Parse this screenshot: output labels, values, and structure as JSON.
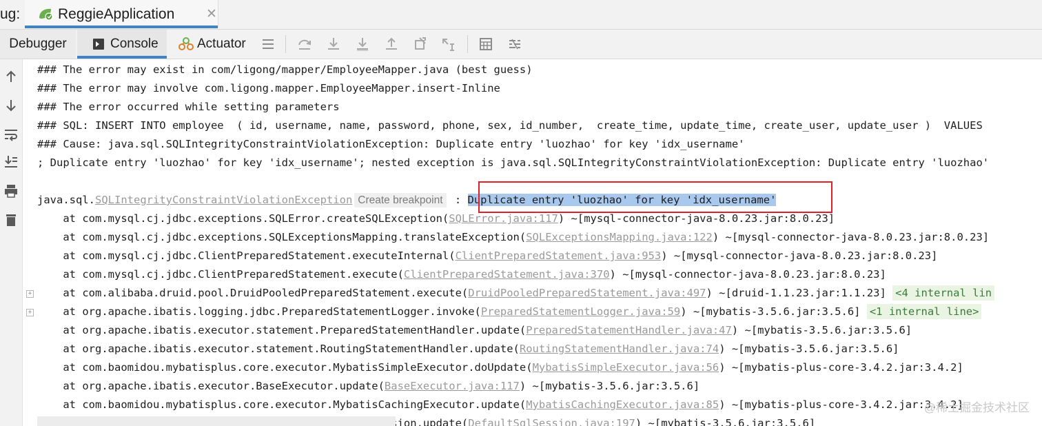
{
  "top_tab": {
    "prefix": "ug:",
    "title": "ReggieApplication",
    "close": "✕"
  },
  "toolbar": {
    "debugger_label": "Debugger",
    "console_label": "Console",
    "actuator_label": "Actuator"
  },
  "console": {
    "header_lines": [
      "### The error may exist in com/ligong/mapper/EmployeeMapper.java (best guess)",
      "### The error may involve com.ligong.mapper.EmployeeMapper.insert-Inline",
      "### The error occurred while setting parameters",
      "### SQL: INSERT INTO employee  ( id, username, name, password, phone, sex, id_number,  create_time, update_time, create_user, update_user )  VALUES",
      "### Cause: java.sql.SQLIntegrityConstraintViolationException: Duplicate entry 'luozhao' for key 'idx_username'",
      "; Duplicate entry 'luozhao' for key 'idx_username'; nested exception is java.sql.SQLIntegrityConstraintViolationException: Duplicate entry 'luozhao'"
    ],
    "exception": {
      "prefix": "java.sql.",
      "class": "SQLIntegrityConstraintViolationException",
      "breakpoint": "Create breakpoint",
      "sep": " : ",
      "message": "Duplicate entry 'luozhao' for key 'idx_username'"
    },
    "stack": [
      {
        "pre": "    at com.mysql.cj.jdbc.exceptions.SQLError.createSQLException(",
        "link": "SQLError.java:117",
        "post": ") ~[mysql-connector-java-8.0.23.jar:8.0.23]",
        "fold": false,
        "internal": ""
      },
      {
        "pre": "    at com.mysql.cj.jdbc.exceptions.SQLExceptionsMapping.translateException(",
        "link": "SQLExceptionsMapping.java:122",
        "post": ") ~[mysql-connector-java-8.0.23.jar:8.0.23]",
        "fold": false,
        "internal": ""
      },
      {
        "pre": "    at com.mysql.cj.jdbc.ClientPreparedStatement.executeInternal(",
        "link": "ClientPreparedStatement.java:953",
        "post": ") ~[mysql-connector-java-8.0.23.jar:8.0.23]",
        "fold": false,
        "internal": ""
      },
      {
        "pre": "    at com.mysql.cj.jdbc.ClientPreparedStatement.execute(",
        "link": "ClientPreparedStatement.java:370",
        "post": ") ~[mysql-connector-java-8.0.23.jar:8.0.23]",
        "fold": false,
        "internal": ""
      },
      {
        "pre": "    at com.alibaba.druid.pool.DruidPooledPreparedStatement.execute(",
        "link": "DruidPooledPreparedStatement.java:497",
        "post": ") ~[druid-1.1.23.jar:1.1.23] ",
        "fold": true,
        "internal": "<4 internal lin"
      },
      {
        "pre": "    at org.apache.ibatis.logging.jdbc.PreparedStatementLogger.invoke(",
        "link": "PreparedStatementLogger.java:59",
        "post": ") ~[mybatis-3.5.6.jar:3.5.6] ",
        "fold": true,
        "internal": "<1 internal line>"
      },
      {
        "pre": "    at org.apache.ibatis.executor.statement.PreparedStatementHandler.update(",
        "link": "PreparedStatementHandler.java:47",
        "post": ") ~[mybatis-3.5.6.jar:3.5.6]",
        "fold": false,
        "internal": ""
      },
      {
        "pre": "    at org.apache.ibatis.executor.statement.RoutingStatementHandler.update(",
        "link": "RoutingStatementHandler.java:74",
        "post": ") ~[mybatis-3.5.6.jar:3.5.6]",
        "fold": false,
        "internal": ""
      },
      {
        "pre": "    at com.baomidou.mybatisplus.core.executor.MybatisSimpleExecutor.doUpdate(",
        "link": "MybatisSimpleExecutor.java:56",
        "post": ") ~[mybatis-plus-core-3.4.2.jar:3.4.2]",
        "fold": false,
        "internal": ""
      },
      {
        "pre": "    at org.apache.ibatis.executor.BaseExecutor.update(",
        "link": "BaseExecutor.java:117",
        "post": ") ~[mybatis-3.5.6.jar:3.5.6]",
        "fold": false,
        "internal": ""
      },
      {
        "pre": "    at com.baomidou.mybatisplus.core.executor.MybatisCachingExecutor.update(",
        "link": "MybatisCachingExecutor.java:85",
        "post": ") ~[mybatis-plus-core-3.4.2.jar:3.4.2]",
        "fold": false,
        "internal": ""
      },
      {
        "pre": "    at org.apache.ibatis.session.defaults.DefaultSqlSession.update(",
        "link": "DefaultSqlSession.java:197",
        "post": ") ~[mybatis-3.5.6.jar:3.5.6]",
        "fold": false,
        "internal": ""
      }
    ]
  },
  "watermark": "@稀土掘金技术社区",
  "colors": {
    "accent": "#4083c9",
    "link": "#9a9a9a",
    "highlight": "#a9c8ee",
    "box": "#e21f26"
  },
  "icons": [
    "spring-leaf-icon",
    "console-icon",
    "actuator-icon",
    "menu-icon",
    "step-over-icon",
    "step-into-icon",
    "force-step-into-icon",
    "step-out-icon",
    "drop-frame-icon",
    "run-to-cursor-icon",
    "evaluate-icon",
    "trace-icon",
    "scroll-up-icon",
    "scroll-down-icon",
    "soft-wrap-icon",
    "scroll-to-end-icon",
    "print-icon",
    "trash-icon"
  ]
}
